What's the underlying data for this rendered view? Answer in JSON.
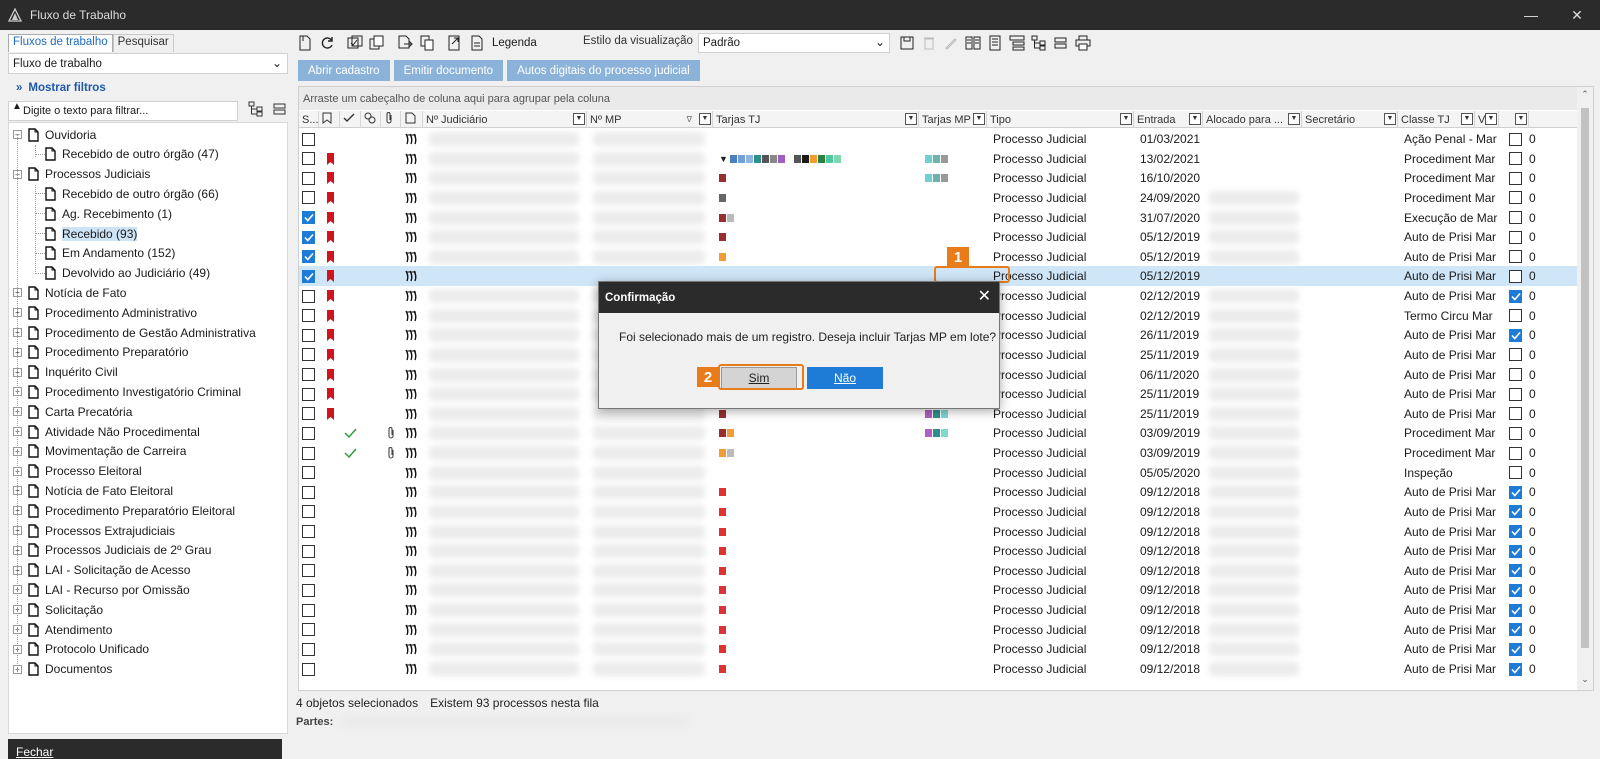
{
  "window": {
    "title": "Fluxo de Trabalho"
  },
  "left": {
    "tabs": [
      "Fluxos de trabalho",
      "Pesquisar"
    ],
    "workflow_select": "Fluxo de trabalho",
    "show_filters": "Mostrar filtros",
    "filter_placeholder": "Digite o texto para filtrar...",
    "tree": [
      {
        "label": "Ouvidoria",
        "level": 0,
        "expander": "minus"
      },
      {
        "label": "Recebido de outro órgão (47)",
        "level": 1
      },
      {
        "label": "Processos Judiciais",
        "level": 0,
        "expander": "minus"
      },
      {
        "label": "Recebido de outro órgão (66)",
        "level": 1
      },
      {
        "label": "Ag. Recebimento (1)",
        "level": 1
      },
      {
        "label": "Recebido (93)",
        "level": 1,
        "selected": true
      },
      {
        "label": "Em Andamento (152)",
        "level": 1
      },
      {
        "label": "Devolvido ao Judiciário (49)",
        "level": 1
      },
      {
        "label": "Notícia de Fato",
        "level": 0,
        "expander": "plus"
      },
      {
        "label": "Procedimento Administrativo",
        "level": 0,
        "expander": "plus"
      },
      {
        "label": "Procedimento de Gestão Administrativa",
        "level": 0,
        "expander": "plus"
      },
      {
        "label": "Procedimento Preparatório",
        "level": 0,
        "expander": "plus"
      },
      {
        "label": "Inquérito Civil",
        "level": 0,
        "expander": "plus"
      },
      {
        "label": "Procedimento Investigatório Criminal",
        "level": 0,
        "expander": "plus"
      },
      {
        "label": "Carta Precatória",
        "level": 0,
        "expander": "plus"
      },
      {
        "label": "Atividade Não Procedimental",
        "level": 0,
        "expander": "plus"
      },
      {
        "label": "Movimentação de Carreira",
        "level": 0,
        "expander": "plus"
      },
      {
        "label": "Processo Eleitoral",
        "level": 0,
        "expander": "plus"
      },
      {
        "label": "Notícia de Fato Eleitoral",
        "level": 0,
        "expander": "plus"
      },
      {
        "label": "Procedimento Preparatório Eleitoral",
        "level": 0,
        "expander": "plus"
      },
      {
        "label": "Processos Extrajudiciais",
        "level": 0,
        "expander": "plus"
      },
      {
        "label": "Processos Judiciais de 2º Grau",
        "level": 0,
        "expander": "plus"
      },
      {
        "label": "LAI - Solicitação de Acesso",
        "level": 0,
        "expander": "plus"
      },
      {
        "label": "LAI - Recurso por Omissão",
        "level": 0,
        "expander": "plus"
      },
      {
        "label": "Solicitação",
        "level": 0,
        "expander": "plus"
      },
      {
        "label": "Atendimento",
        "level": 0,
        "expander": "plus"
      },
      {
        "label": "Protocolo Unificado",
        "level": 0,
        "expander": "plus"
      },
      {
        "label": "Documentos",
        "level": 0,
        "expander": "plus"
      }
    ],
    "close_label": "Fechar"
  },
  "toolbar": {
    "legend_label": "Legenda",
    "style_label": "Estilo da visualização",
    "style_value": "Padrão"
  },
  "actions": [
    "Abrir cadastro",
    "Emitir documento",
    "Autos digitais do processo judicial"
  ],
  "grid": {
    "group_hint": "Arraste um cabeçalho de coluna aqui para agrupar pela coluna",
    "headers": {
      "select": "S...",
      "judicial_no": "Nº Judiciário",
      "mp_no": "Nº MP",
      "tarjas_tj": "Tarjas TJ",
      "tarjas_mp": "Tarjas MP",
      "tipo": "Tipo",
      "entrada": "Entrada",
      "alocado": "Alocado para ...",
      "secretario": "Secretário",
      "classe_tj": "Classe TJ",
      "v": "V"
    },
    "rows": [
      {
        "checked": false,
        "flag": false,
        "tj": [],
        "mp": [],
        "tipo": "Processo Judicial",
        "entrada": "01/03/2021",
        "classe": "Ação Penal - Mar",
        "v": false,
        "n": "0"
      },
      {
        "checked": false,
        "flag": true,
        "tj": [
          "#1a1a1a",
          "#4a7fc0",
          "#6fa0d8",
          "#8fb6e0",
          "#2f8f8f",
          "#555",
          "#888",
          "#a05fc0",
          "",
          "#555",
          "#1a1a1a",
          "#f39c33",
          "#2f7f3f",
          "#4cc9a0",
          "#7fd8b0"
        ],
        "mp": [
          "#6fd0d0",
          "#6fb0b0",
          "#999"
        ],
        "tipo": "Processo Judicial",
        "entrada": "13/02/2021",
        "classe": "Procediment Mar",
        "v": false,
        "n": "0"
      },
      {
        "checked": false,
        "flag": true,
        "tj": [
          "#9b2f2f"
        ],
        "mp": [
          "#6fd0d0",
          "#6fb0b0",
          "#999"
        ],
        "tipo": "Processo Judicial",
        "entrada": "16/10/2020",
        "classe": "Procediment Mar",
        "v": false,
        "n": "0"
      },
      {
        "checked": false,
        "flag": true,
        "tj": [
          "#666"
        ],
        "mp": [],
        "tipo": "Processo Judicial",
        "entrada": "24/09/2020",
        "classe": "Procediment Mar",
        "v": false,
        "n": "0"
      },
      {
        "checked": true,
        "flag": true,
        "tj": [
          "#9b2f2f",
          "#bbb"
        ],
        "mp": [],
        "tipo": "Processo Judicial",
        "entrada": "31/07/2020",
        "classe": "Execução de Mar",
        "v": false,
        "n": "0"
      },
      {
        "checked": true,
        "flag": true,
        "tj": [
          "#9b2f2f"
        ],
        "mp": [],
        "tipo": "Processo Judicial",
        "entrada": "05/12/2019",
        "classe": "Auto de Prisi Mar",
        "v": false,
        "n": "0"
      },
      {
        "checked": true,
        "flag": true,
        "tj": [
          "#f39c33"
        ],
        "mp": [],
        "tipo": "Processo Judicial",
        "entrada": "05/12/2019",
        "classe": "Auto de Prisi Mar",
        "v": false,
        "n": "0"
      },
      {
        "checked": true,
        "flag": true,
        "tj": [],
        "mp": [],
        "tipo": "Processo Judicial",
        "entrada": "05/12/2019",
        "classe": "Auto de Prisi Mar",
        "v": false,
        "n": "0",
        "selected": true
      },
      {
        "checked": false,
        "flag": true,
        "tj": [],
        "mp": [],
        "tipo": "Processo Judicial",
        "entrada": "02/12/2019",
        "classe": "Auto de Prisi Mar",
        "v": true,
        "n": "0"
      },
      {
        "checked": false,
        "flag": true,
        "tj": [],
        "mp": [],
        "tipo": "Processo Judicial",
        "entrada": "02/12/2019",
        "classe": "Termo Circu Mar",
        "v": false,
        "n": "0"
      },
      {
        "checked": false,
        "flag": true,
        "tj": [],
        "mp": [],
        "tipo": "Processo Judicial",
        "entrada": "26/11/2019",
        "classe": "Auto de Prisi Mar",
        "v": true,
        "n": "0"
      },
      {
        "checked": false,
        "flag": true,
        "tj": [],
        "mp": [],
        "tipo": "Processo Judicial",
        "entrada": "25/11/2019",
        "classe": "Auto de Prisi Mar",
        "v": false,
        "n": "0"
      },
      {
        "checked": false,
        "flag": true,
        "tj": [],
        "mp": [],
        "tipo": "Processo Judicial",
        "entrada": "06/11/2020",
        "classe": "Auto de Prisi Mar",
        "v": false,
        "n": "0"
      },
      {
        "checked": false,
        "flag": true,
        "tj": [],
        "mp": [],
        "tipo": "Processo Judicial",
        "entrada": "25/11/2019",
        "classe": "Auto de Prisi Mar",
        "v": false,
        "n": "0"
      },
      {
        "checked": false,
        "flag": true,
        "tj": [
          "#9b2f2f"
        ],
        "mp": [
          "#b060c0",
          "#2f8f8f",
          "#7fd8d0"
        ],
        "tipo": "Processo Judicial",
        "entrada": "25/11/2019",
        "classe": "Auto de Prisi Mar",
        "v": false,
        "n": "0"
      },
      {
        "checked": false,
        "flag": false,
        "check": true,
        "clip": true,
        "tj": [
          "#9b2f2f",
          "#f39c33"
        ],
        "mp": [
          "#b060c0",
          "#2f8f8f",
          "#7fd8d0"
        ],
        "tipo": "Processo Judicial",
        "entrada": "03/09/2019",
        "classe": "Procediment Mar",
        "v": false,
        "n": "0"
      },
      {
        "checked": false,
        "flag": false,
        "check": true,
        "clip": true,
        "tj": [
          "#f39c33",
          "#bbb"
        ],
        "mp": [],
        "tipo": "Processo Judicial",
        "entrada": "03/09/2019",
        "classe": "Procediment Mar",
        "v": false,
        "n": "0"
      },
      {
        "checked": false,
        "flag": false,
        "tj": [],
        "mp": [],
        "tipo": "Processo Judicial",
        "entrada": "05/05/2020",
        "classe": "Inspeção",
        "v": false,
        "n": "0"
      },
      {
        "checked": false,
        "flag": false,
        "tj": [
          "#d33"
        ],
        "mp": [],
        "tipo": "Processo Judicial",
        "entrada": "09/12/2018",
        "classe": "Auto de Prisi Mar",
        "v": true,
        "n": "0"
      },
      {
        "checked": false,
        "flag": false,
        "tj": [
          "#d33"
        ],
        "mp": [],
        "tipo": "Processo Judicial",
        "entrada": "09/12/2018",
        "classe": "Auto de Prisi Mar",
        "v": true,
        "n": "0"
      },
      {
        "checked": false,
        "flag": false,
        "tj": [
          "#d33"
        ],
        "mp": [],
        "tipo": "Processo Judicial",
        "entrada": "09/12/2018",
        "classe": "Auto de Prisi Mar",
        "v": true,
        "n": "0"
      },
      {
        "checked": false,
        "flag": false,
        "tj": [
          "#d33"
        ],
        "mp": [],
        "tipo": "Processo Judicial",
        "entrada": "09/12/2018",
        "classe": "Auto de Prisi Mar",
        "v": true,
        "n": "0"
      },
      {
        "checked": false,
        "flag": false,
        "tj": [
          "#d33"
        ],
        "mp": [],
        "tipo": "Processo Judicial",
        "entrada": "09/12/2018",
        "classe": "Auto de Prisi Mar",
        "v": true,
        "n": "0"
      },
      {
        "checked": false,
        "flag": false,
        "tj": [
          "#d33"
        ],
        "mp": [],
        "tipo": "Processo Judicial",
        "entrada": "09/12/2018",
        "classe": "Auto de Prisi Mar",
        "v": true,
        "n": "0"
      },
      {
        "checked": false,
        "flag": false,
        "tj": [
          "#d33"
        ],
        "mp": [],
        "tipo": "Processo Judicial",
        "entrada": "09/12/2018",
        "classe": "Auto de Prisi Mar",
        "v": true,
        "n": "0"
      },
      {
        "checked": false,
        "flag": false,
        "tj": [
          "#d33"
        ],
        "mp": [],
        "tipo": "Processo Judicial",
        "entrada": "09/12/2018",
        "classe": "Auto de Prisi Mar",
        "v": true,
        "n": "0"
      },
      {
        "checked": false,
        "flag": false,
        "tj": [
          "#d33"
        ],
        "mp": [],
        "tipo": "Processo Judicial",
        "entrada": "09/12/2018",
        "classe": "Auto de Prisi Mar",
        "v": true,
        "n": "0"
      },
      {
        "checked": false,
        "flag": false,
        "tj": [
          "#d33"
        ],
        "mp": [],
        "tipo": "Processo Judicial",
        "entrada": "09/12/2018",
        "classe": "Auto de Prisi Mar",
        "v": true,
        "n": "0"
      }
    ]
  },
  "status": {
    "selected": "4 objetos selecionados",
    "total": "Existem 93 processos nesta fila",
    "partes_label": "Partes:"
  },
  "annotations": [
    "1",
    "2"
  ],
  "dialog": {
    "title": "Confirmação",
    "message": "Foi selecionado mais de um registro. Deseja incluir Tarjas MP em lote?",
    "yes_label": "Sim",
    "no_label": "Não"
  },
  "colors": {
    "accent": "#1e7bd6",
    "annotation": "#e87b1a",
    "titlebar": "#2b2b2b",
    "action_button": "#8bb3d9",
    "flag": "#d0141e"
  }
}
